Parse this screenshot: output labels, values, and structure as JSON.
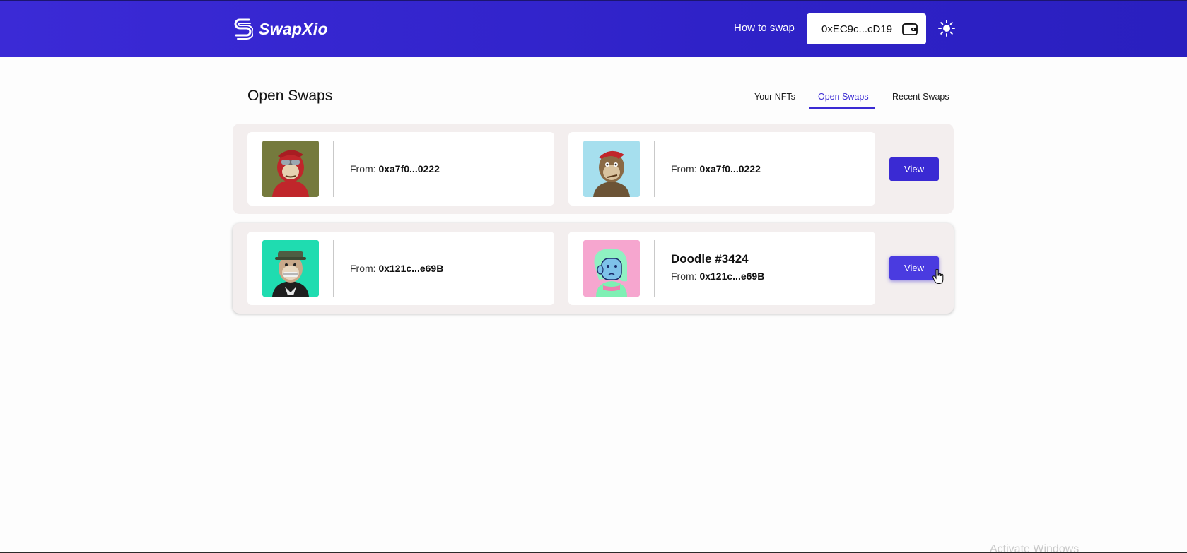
{
  "app": {
    "name": "SwapXio",
    "accent_color": "#3a2ad3",
    "header_color": "#3127cc"
  },
  "header": {
    "how_to_swap": "How to swap",
    "wallet_address": "0xEC9c...cD19",
    "wallet_icon": "wallet-icon",
    "theme_icon": "sun-icon"
  },
  "page": {
    "title": "Open Swaps"
  },
  "tabs": [
    {
      "label": "Your NFTs",
      "active": false
    },
    {
      "label": "Open Swaps",
      "active": true
    },
    {
      "label": "Recent Swaps",
      "active": false
    }
  ],
  "swaps": [
    {
      "left": {
        "from_label": "From:",
        "from_address": "0xa7f0...0222",
        "image": "bored-ape-olive-background"
      },
      "right": {
        "from_label": "From:",
        "from_address": "0xa7f0...0222",
        "image": "bored-ape-light-blue-background"
      },
      "view_label": "View"
    },
    {
      "left": {
        "from_label": "From:",
        "from_address": "0x121c...e69B",
        "image": "bored-ape-teal-background"
      },
      "right": {
        "name": "Doodle #3424",
        "from_label": "From:",
        "from_address": "0x121c...e69B",
        "image": "doodle-pink-background"
      },
      "view_label": "View"
    }
  ],
  "os_watermark": "Activate Windows"
}
